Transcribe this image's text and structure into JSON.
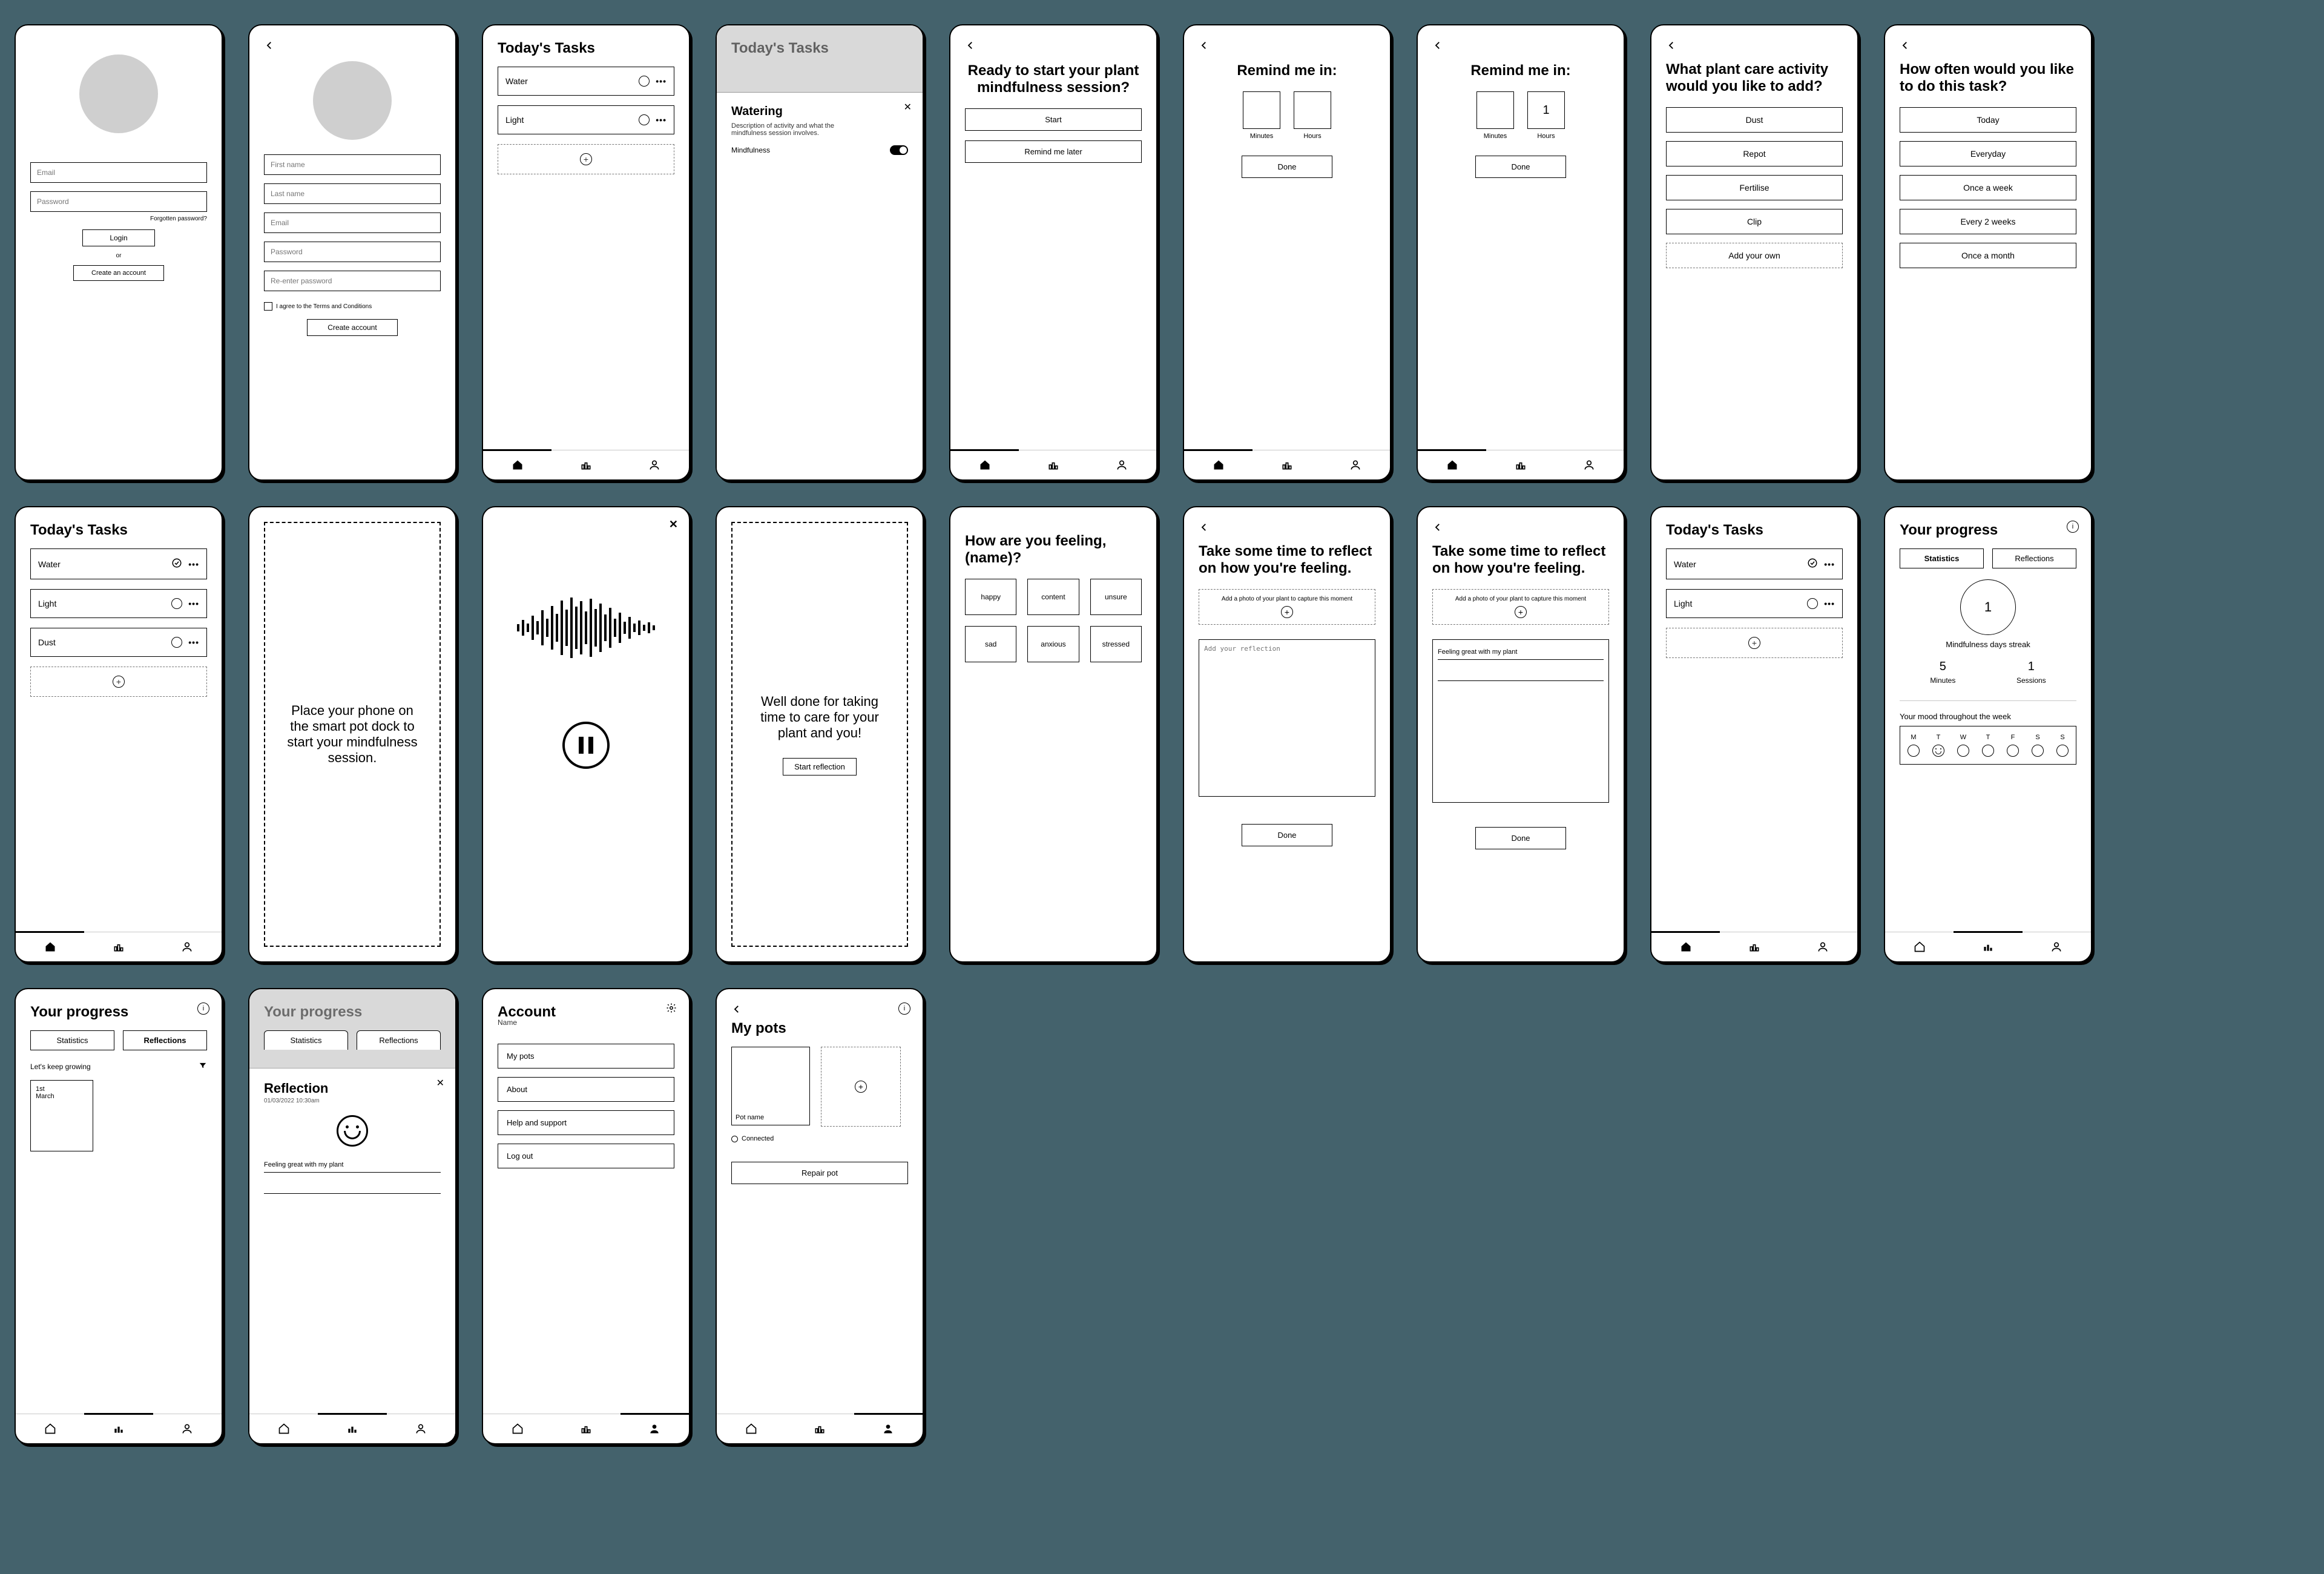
{
  "login": {
    "email_ph": "Email",
    "password_ph": "Password",
    "forgot": "Forgotten password?",
    "login_btn": "Login",
    "or": "or",
    "create": "Create an account"
  },
  "signup": {
    "first_ph": "First name",
    "last_ph": "Last name",
    "email_ph": "Email",
    "pw_ph": "Password",
    "pw2_ph": "Re-enter password",
    "terms": "I agree to the Terms and Conditions",
    "create": "Create account"
  },
  "tasks": {
    "title": "Today's Tasks",
    "water": "Water",
    "light": "Light",
    "dust": "Dust"
  },
  "panel": {
    "title": "Watering",
    "desc": "Description of activity and what the mindfulness session involves.",
    "mindfulness": "Mindfulness"
  },
  "start": {
    "q": "Ready to start your plant mindfulness session?",
    "start": "Start",
    "later": "Remind me later"
  },
  "remind": {
    "title": "Remind me in:",
    "minutes": "Minutes",
    "hours": "Hours",
    "hours_val": "1",
    "done": "Done"
  },
  "activity": {
    "q": "What plant care activity would you like to add?",
    "dust": "Dust",
    "repot": "Repot",
    "fertilise": "Fertilise",
    "clip": "Clip",
    "add_own": "Add your own"
  },
  "freq": {
    "q": "How often would you like to do this task?",
    "today": "Today",
    "everyday": "Everyday",
    "once_week": "Once a week",
    "two_weeks": "Every 2 weeks",
    "month": "Once a month"
  },
  "dock": {
    "msg": "Place your phone on the smart pot dock to start your mindfulness session."
  },
  "done_panel": {
    "msg": "Well done for taking time to care for your plant and you!",
    "start_reflection": "Start reflection"
  },
  "feel": {
    "q": "How are you feeling, (name)?",
    "happy": "happy",
    "content": "content",
    "unsure": "unsure",
    "sad": "sad",
    "anxious": "anxious",
    "stressed": "stressed"
  },
  "reflect": {
    "q": "Take some time to reflect on how you're feeling.",
    "photo": "Add a photo of your plant to capture this moment",
    "placeholder": "Add your reflection",
    "sample": "Feeling great with my plant",
    "done": "Done"
  },
  "progress": {
    "title": "Your progress",
    "stats": "Statistics",
    "reflections": "Reflections",
    "streak_num": "1",
    "streak_lbl": "Mindfulness days streak",
    "minutes_n": "5",
    "minutes_l": "Minutes",
    "sessions_n": "1",
    "sessions_l": "Sessions",
    "mood_h": "Your mood throughout the week",
    "days": [
      "M",
      "T",
      "W",
      "T",
      "F",
      "S",
      "S"
    ],
    "filter": "Let's keep growing",
    "card_t": "1st",
    "card_b": "March"
  },
  "refmodal": {
    "title": "Reflection",
    "date": "01/03/2022 10:30am",
    "text": "Feeling great with my plant"
  },
  "account": {
    "title": "Account",
    "name": "Name",
    "pots": "My pots",
    "about": "About",
    "help": "Help and support",
    "logout": "Log out"
  },
  "mypots": {
    "title": "My pots",
    "pot_name": "Pot name",
    "connected": "Connected",
    "repair": "Repair pot"
  }
}
